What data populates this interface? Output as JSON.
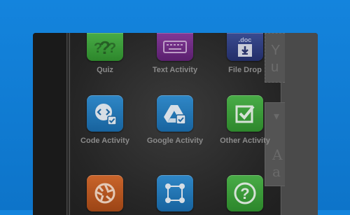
{
  "activities": [
    {
      "label": "Quiz",
      "icon": "question-marks-icon",
      "color": "#3a9d38"
    },
    {
      "label": "Text Activity",
      "icon": "keyboard-icon",
      "color": "#742c8a"
    },
    {
      "label": "File Drop",
      "icon": "doc-download-icon",
      "badge": ".doc",
      "color": "#2f3d84"
    },
    {
      "label": "Code Activity",
      "icon": "code-bubble-icon",
      "color": "#2379bd"
    },
    {
      "label": "Google Activity",
      "icon": "google-drive-icon",
      "color": "#2379bd"
    },
    {
      "label": "Other Activity",
      "icon": "checkbox-icon",
      "color": "#3a9d38"
    },
    {
      "label": "",
      "icon": "aperture-icon",
      "color": "#c05a22"
    },
    {
      "label": "",
      "icon": "nodes-icon",
      "color": "#2379bd"
    },
    {
      "label": "",
      "icon": "question-circle-icon",
      "color": "#3a9d38"
    }
  ],
  "side_panel": {
    "box1_text": "Y\nu",
    "box2_text_1": "A",
    "box2_text_2": "a"
  }
}
